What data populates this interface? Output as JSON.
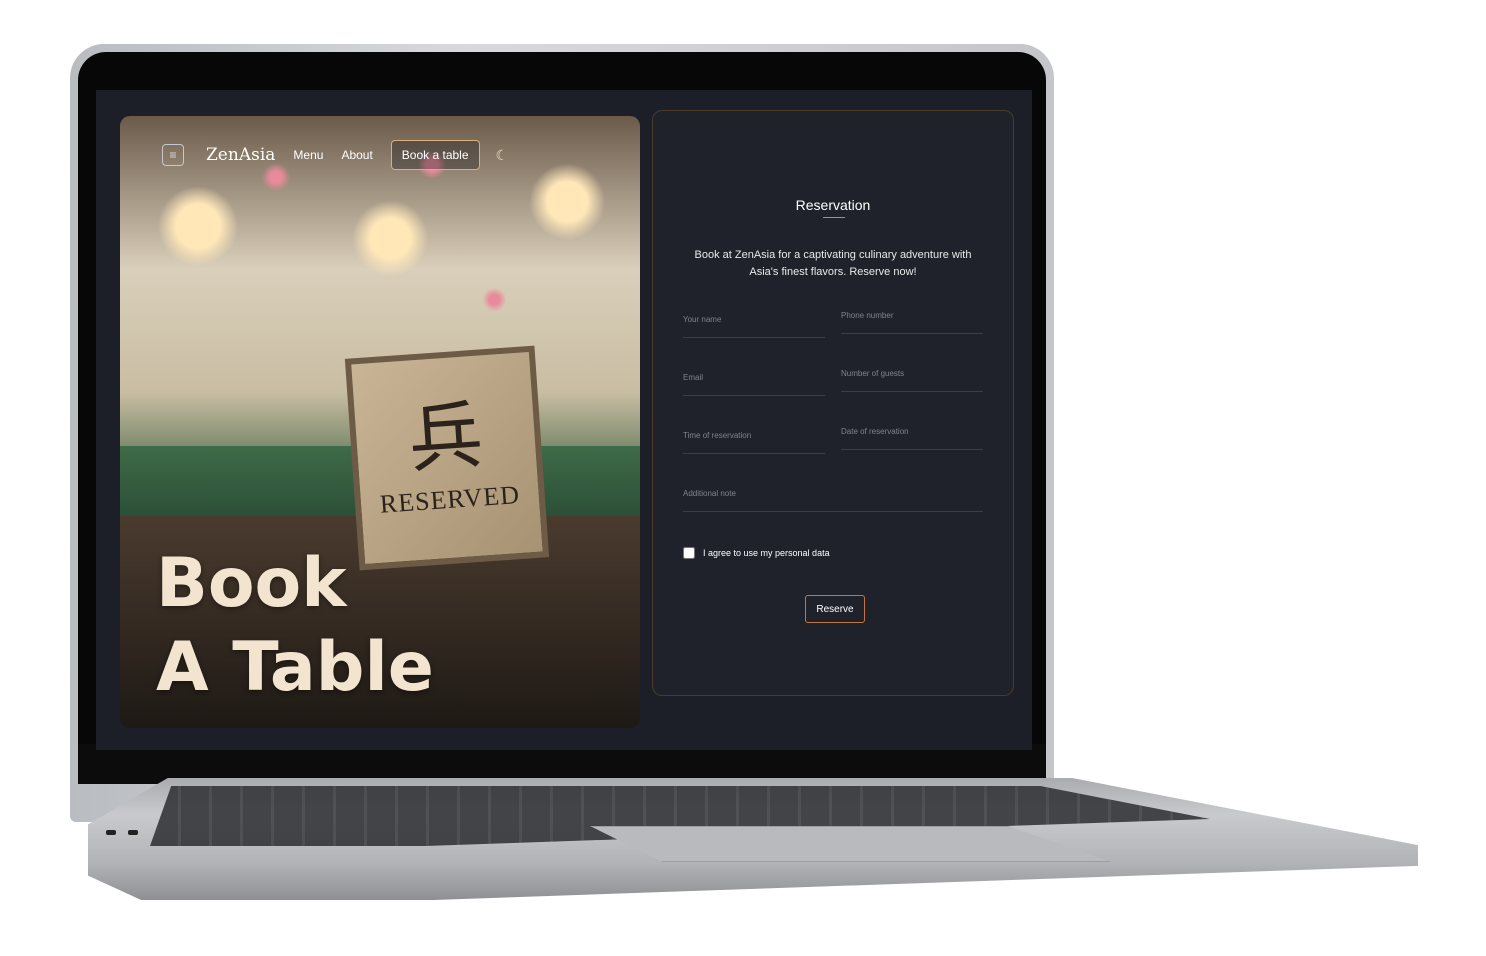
{
  "nav": {
    "logo": "ZenAsia",
    "links": [
      "Menu",
      "About"
    ],
    "cta": "Book a table"
  },
  "hero": {
    "title_line1": "Book",
    "title_line2": "A Table",
    "sign_text": "RESERVED"
  },
  "reservation": {
    "title": "Reservation",
    "description": "Book at ZenAsia for a captivating culinary adventure with Asia's finest flavors. Reserve now!",
    "fields": {
      "name": "Your name",
      "phone": "Phone number",
      "email": "Email",
      "guests": "Number of guests",
      "time": "Time of reservation",
      "date": "Date of reservation",
      "note": "Additional note"
    },
    "agree_label": "I agree to use my personal data",
    "submit": "Reserve"
  },
  "colors": {
    "background": "#1c1f27",
    "accent": "#c1763e",
    "hero_text": "#f2e4cf"
  }
}
